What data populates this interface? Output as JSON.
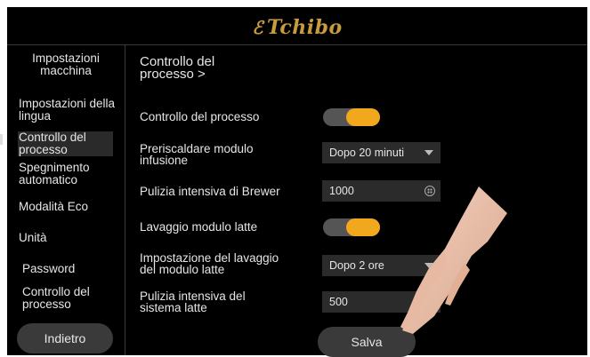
{
  "brand": {
    "logo_text": "Tchibo"
  },
  "sidebar": {
    "title": "Impostazioni macchina",
    "items": [
      {
        "label": "Impostazioni della lingua",
        "active": false
      },
      {
        "label": "Controllo del processo",
        "active": true
      },
      {
        "label": "Spegnimento automatico",
        "active": false
      },
      {
        "label": "Modalità Eco",
        "active": false
      },
      {
        "label": "Unità",
        "active": false
      },
      {
        "label": "Password",
        "active": false
      },
      {
        "label": "Controllo del processo",
        "active": false
      }
    ],
    "back_label": "Indietro"
  },
  "main": {
    "breadcrumb": "Controllo del processo >",
    "rows": {
      "process_control": {
        "label": "Controllo del processo",
        "toggle_on": true
      },
      "preheat": {
        "label": "Preriscaldare modulo infusione",
        "value": "Dopo 20 minuti"
      },
      "brewer_clean": {
        "label": "Pulizia intensiva di Brewer",
        "value": "1000"
      },
      "milk_wash": {
        "label": "Lavaggio modulo latte",
        "toggle_on": true
      },
      "milk_wash_setting": {
        "label": "Impostazione del lavaggio del modulo latte",
        "value": "Dopo 2 ore"
      },
      "milk_clean": {
        "label": "Pulizia intensiva del sistema latte",
        "value": "500"
      }
    },
    "save_label": "Salva"
  },
  "colors": {
    "accent": "#f2a81d",
    "logo": "#c89b3c",
    "background": "#000000",
    "button": "#3a3a3a"
  }
}
